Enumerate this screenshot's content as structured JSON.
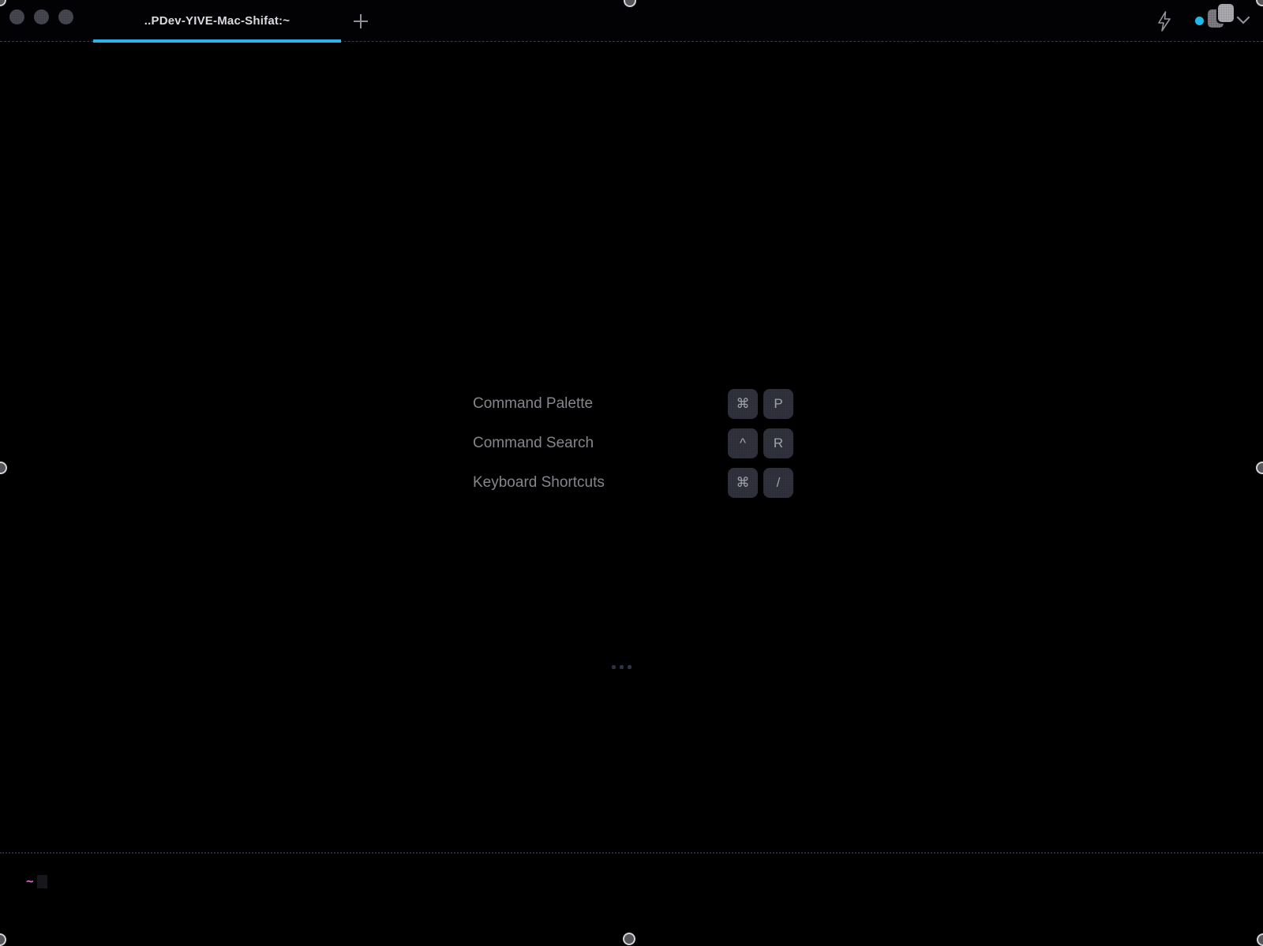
{
  "colors": {
    "accent_cyan": "#29b4ec",
    "status_dot": "#24b7e9",
    "prompt_pink": "#e263da"
  },
  "tab_bar": {
    "title": "..PDev-YIVE-Mac-Shifat:~",
    "new_tab_glyph": "+"
  },
  "shortcut_hints": {
    "items": [
      {
        "label": "Command Palette",
        "keys": [
          "⌘",
          "P"
        ]
      },
      {
        "label": "Command Search",
        "keys": [
          "^",
          "R"
        ]
      },
      {
        "label": "Keyboard Shortcuts",
        "keys": [
          "⌘",
          "/"
        ]
      }
    ]
  },
  "terminal": {
    "prompt_symbol": "~"
  },
  "icons": {
    "quick_actions": "lightning-icon",
    "session_status": "status-dot",
    "split_panes": "split-panes-icon",
    "menu": "chevron-down-icon",
    "more_options": "ellipsis-dots",
    "new_tab": "plus-icon"
  }
}
